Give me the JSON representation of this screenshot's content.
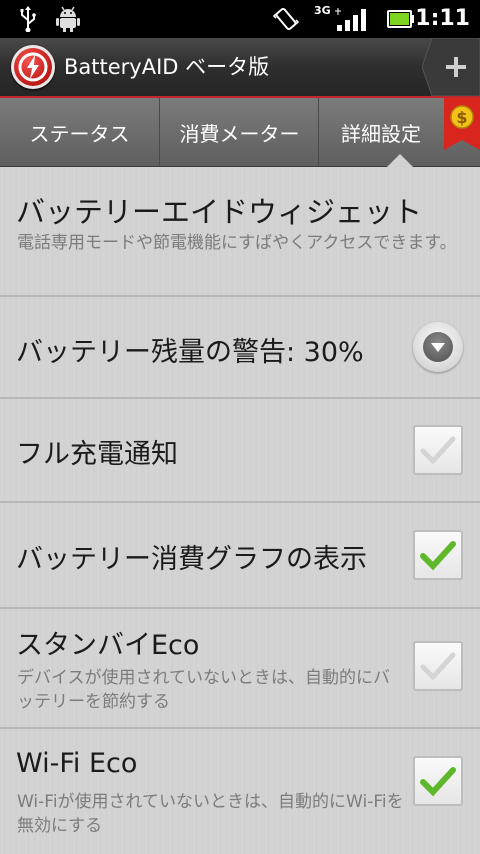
{
  "status_bar": {
    "network_label": "3G",
    "time": "1:11",
    "icons": [
      "usb-icon",
      "android-debug-icon",
      "vibrate-icon",
      "signal-icon",
      "battery-icon"
    ]
  },
  "header": {
    "title": "BatteryAID ベータ版",
    "add_label": "+"
  },
  "tabs": [
    {
      "label": "ステータス",
      "selected": false
    },
    {
      "label": "消費メーター",
      "selected": false
    },
    {
      "label": "詳細設定",
      "selected": true
    }
  ],
  "settings": {
    "widget": {
      "title": "バッテリーエイドウィジェット",
      "description": "電話専用モードや節電機能にすばやくアクセスできます。"
    },
    "low_battery_warning": {
      "title": "バッテリー残量の警告: 30%"
    },
    "full_charge_notice": {
      "title": "フル充電通知",
      "checked": true,
      "enabled": false
    },
    "consumption_graph": {
      "title": "バッテリー消費グラフの表示",
      "checked": true,
      "enabled": true
    },
    "standby_eco": {
      "title": "スタンバイEco",
      "description": "デバイスが使用されていないときは、自動的にバッテリーを節約する",
      "checked": true,
      "enabled": false
    },
    "wifi_eco": {
      "title": "Wi-Fi Eco",
      "description": "Wi-Fiが使用されていないときは、自動的にWi-Fiを無効にする",
      "checked": true,
      "enabled": true
    }
  },
  "colors": {
    "accent_red": "#c1272d",
    "check_green": "#5fb82c",
    "battery_green": "#7ed321"
  }
}
